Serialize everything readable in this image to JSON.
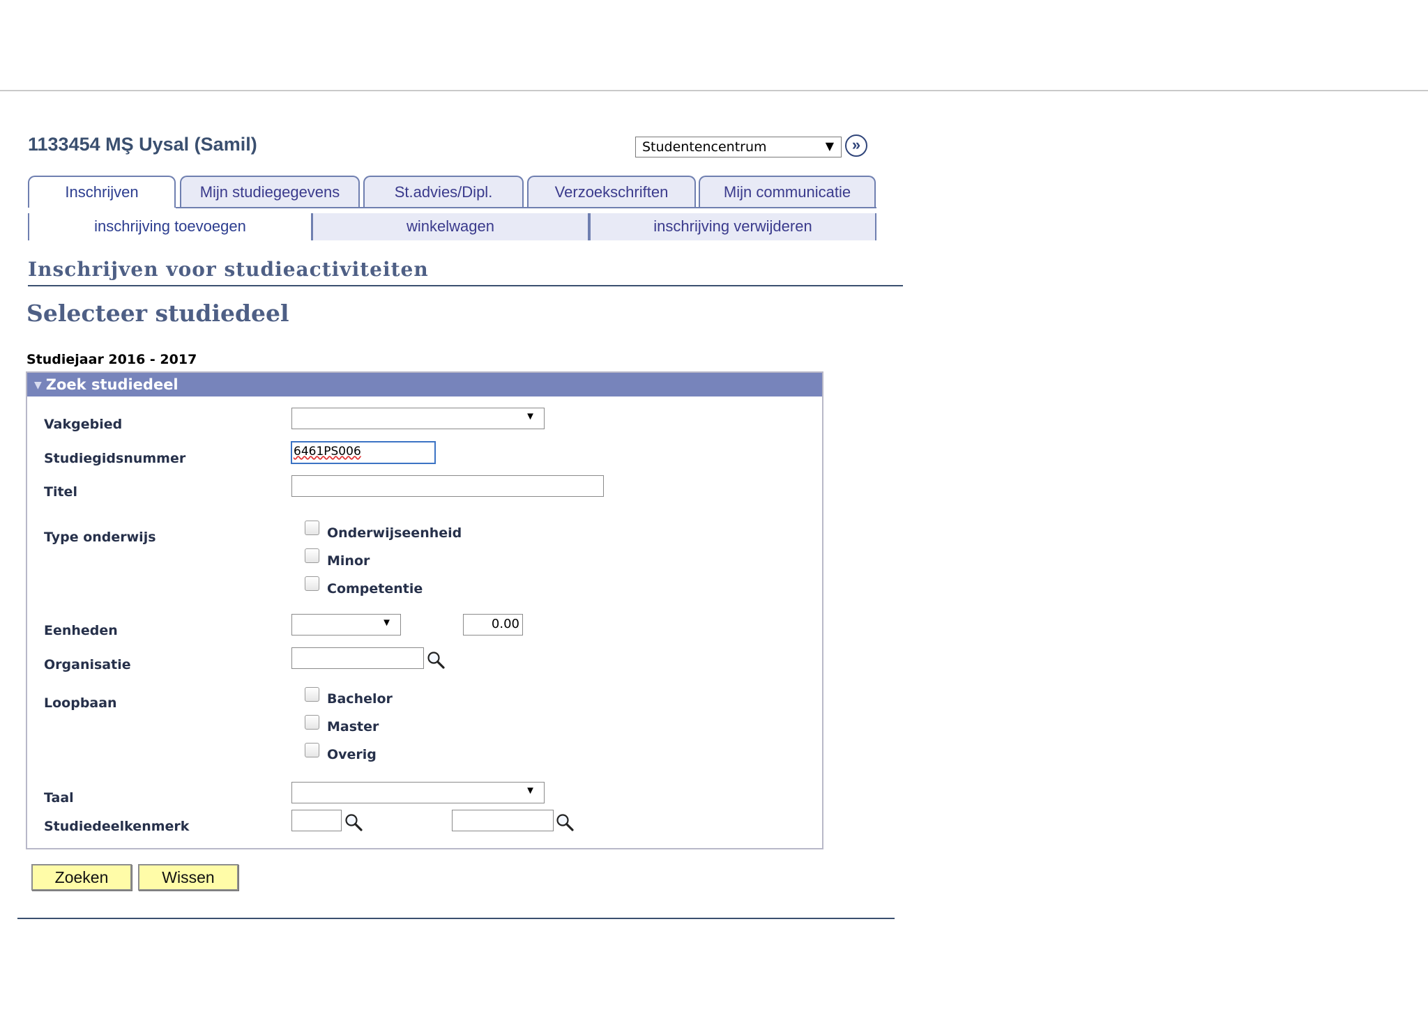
{
  "header": {
    "student": "1133454 MŞ Uysal (Samil)",
    "nav_select_value": "Studentencentrum",
    "go_symbol": "»"
  },
  "tabs": [
    {
      "label": "Inschrijven",
      "active": true
    },
    {
      "label": "Mijn studiegegevens",
      "active": false
    },
    {
      "label": "St.advies/Dipl.",
      "active": false
    },
    {
      "label": "Verzoekschriften",
      "active": false
    },
    {
      "label": "Mijn communicatie",
      "active": false
    }
  ],
  "subtabs": [
    {
      "label": "inschrijving toevoegen",
      "active": true
    },
    {
      "label": "winkelwagen",
      "active": false
    },
    {
      "label": "inschrijving verwijderen",
      "active": false
    }
  ],
  "page": {
    "title": "Inschrijven voor studieactiviteiten",
    "section": "Selecteer studiedeel",
    "year": "Studiejaar 2016 - 2017"
  },
  "search": {
    "header": "Zoek studiedeel",
    "labels": {
      "vakgebied": "Vakgebied",
      "studiegidsnummer": "Studiegidsnummer",
      "titel": "Titel",
      "type_onderwijs": "Type onderwijs",
      "eenheden": "Eenheden",
      "organisatie": "Organisatie",
      "loopbaan": "Loopbaan",
      "taal": "Taal",
      "studiedeelkenmerk": "Studiedeelkenmerk"
    },
    "values": {
      "vakgebied": "",
      "studiegidsnummer": "6461PS006",
      "titel": "",
      "eenheden_operator": "",
      "eenheden_value": "0.00",
      "organisatie": "",
      "taal": "",
      "kenmerk_1": "",
      "kenmerk_2": ""
    },
    "type_onderwijs_options": [
      "Onderwijseenheid",
      "Minor",
      "Competentie"
    ],
    "loopbaan_options": [
      "Bachelor",
      "Master",
      "Overig"
    ]
  },
  "buttons": {
    "search": "Zoeken",
    "clear": "Wissen"
  },
  "colors": {
    "panel_header": "#7784bb",
    "tab_border": "#6f7fb0",
    "button_bg": "#fffca8",
    "heading": "#4e5f85"
  }
}
